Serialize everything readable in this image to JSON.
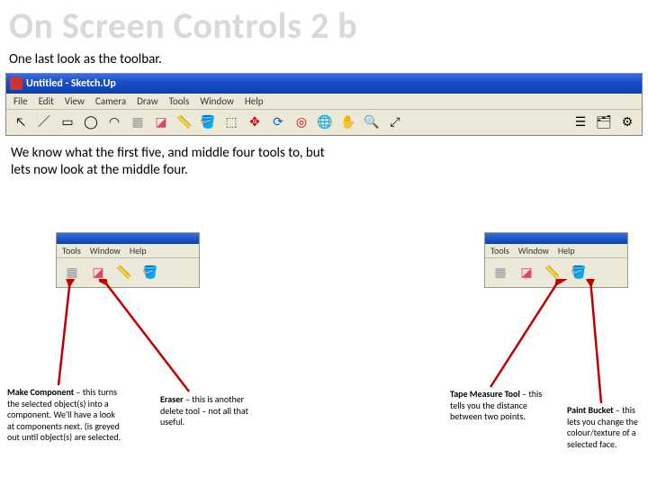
{
  "title": "On Screen Controls 2 b",
  "intro": "One last look as the toolbar.",
  "app": {
    "window_title": "Untitled - Sketch.Up",
    "menu": [
      "File",
      "Edit",
      "View",
      "Camera",
      "Draw",
      "Tools",
      "Window",
      "Help"
    ]
  },
  "mid_caption": "We know what the first five, and middle four tools to, but lets now look at the middle four.",
  "snip_menu": [
    "Tools",
    "Window",
    "Help"
  ],
  "callouts": {
    "make_component": {
      "bold": "Make Component",
      "rest": " – this turns the selected object(s) into a component. We'll have a look at components next. (is greyed out until object(s) are selected."
    },
    "eraser": {
      "bold": "Eraser",
      "rest": " – this is another delete tool – not all that useful."
    },
    "tape": {
      "bold": "Tape Measure Tool",
      "rest": " – this tells you the distance between two points."
    },
    "paint": {
      "bold": "Paint Bucket",
      "rest": " – this lets you change the colour/texture of a selected face."
    }
  }
}
